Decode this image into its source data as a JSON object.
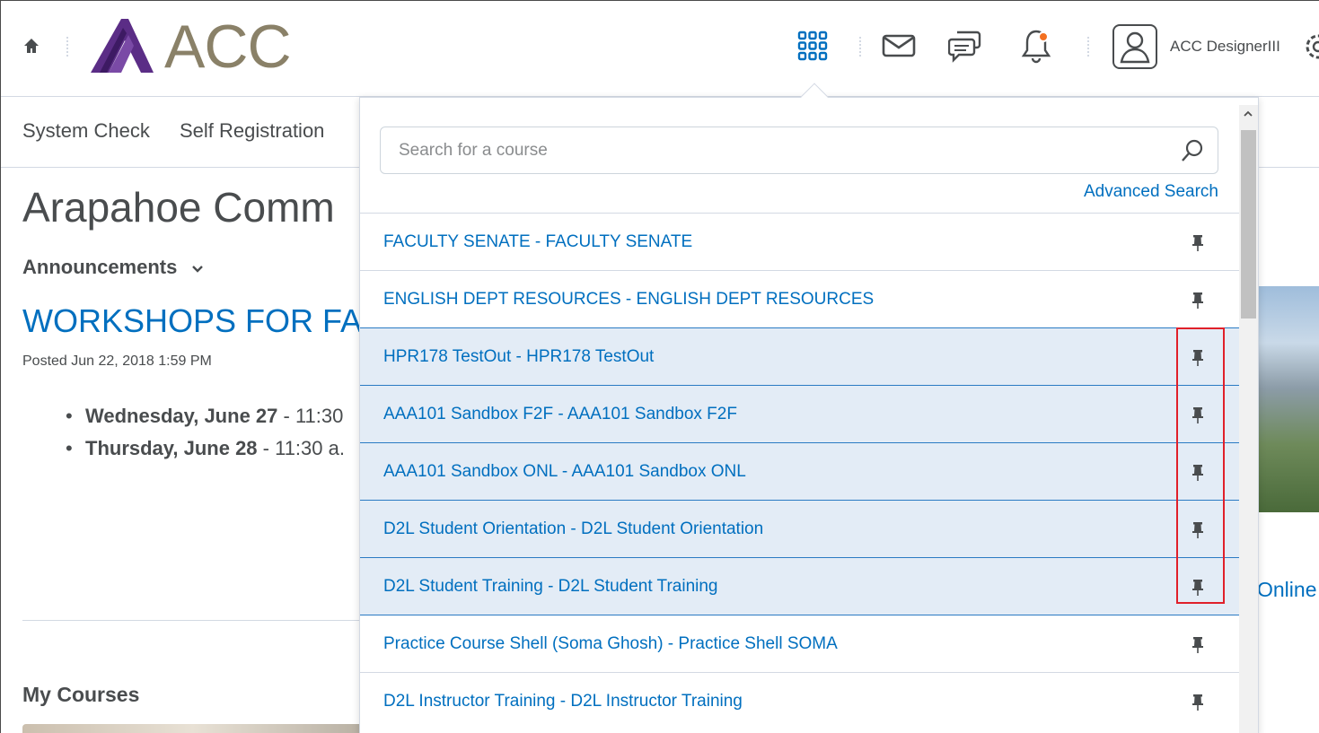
{
  "header": {
    "logo_text": "ACC",
    "user_name": "ACC DesignerIII",
    "icons": [
      "home-icon",
      "course-selector-icon",
      "message-icon",
      "chat-icon",
      "notification-bell-icon",
      "avatar-icon",
      "gear-icon"
    ],
    "notification_color": "#f37021"
  },
  "nav": {
    "items": [
      "System Check",
      "Self Registration"
    ]
  },
  "page": {
    "title": "Arapahoe Comm",
    "announcements_label": "Announcements",
    "announcement_title": "WORKSHOPS FOR FA",
    "posted": "Posted Jun 22, 2018 1:59 PM",
    "bullets": [
      {
        "bold": "Wednesday, June 27",
        "rest": " - 11:30"
      },
      {
        "bold": "Thursday, June 28",
        "rest": " - 11:30 a."
      }
    ],
    "my_courses_label": "My Courses",
    "online_link": "Online"
  },
  "course_selector": {
    "search_placeholder": "Search for a course",
    "advanced_search": "Advanced Search",
    "courses": [
      {
        "name": "FACULTY SENATE - FACULTY SENATE",
        "pinned": false
      },
      {
        "name": "ENGLISH DEPT RESOURCES - ENGLISH DEPT RESOURCES",
        "pinned": false
      },
      {
        "name": "HPR178 TestOut - HPR178 TestOut",
        "pinned": true
      },
      {
        "name": "AAA101 Sandbox F2F - AAA101 Sandbox F2F",
        "pinned": true
      },
      {
        "name": "AAA101 Sandbox ONL - AAA101 Sandbox ONL",
        "pinned": true
      },
      {
        "name": "D2L Student Orientation - D2L Student Orientation",
        "pinned": true
      },
      {
        "name": "D2L Student Training - D2L Student Training",
        "pinned": true
      },
      {
        "name": "Practice Course Shell (Soma Ghosh) - Practice Shell SOMA",
        "pinned": false
      },
      {
        "name": "D2L Instructor Training - D2L Instructor Training",
        "pinned": false
      }
    ]
  },
  "colors": {
    "link": "#006fbf",
    "pinned_row": "#e3ecf6",
    "logo_purple": "#5b2d86",
    "logo_text": "#8a8168",
    "highlight": "#e0202a"
  }
}
